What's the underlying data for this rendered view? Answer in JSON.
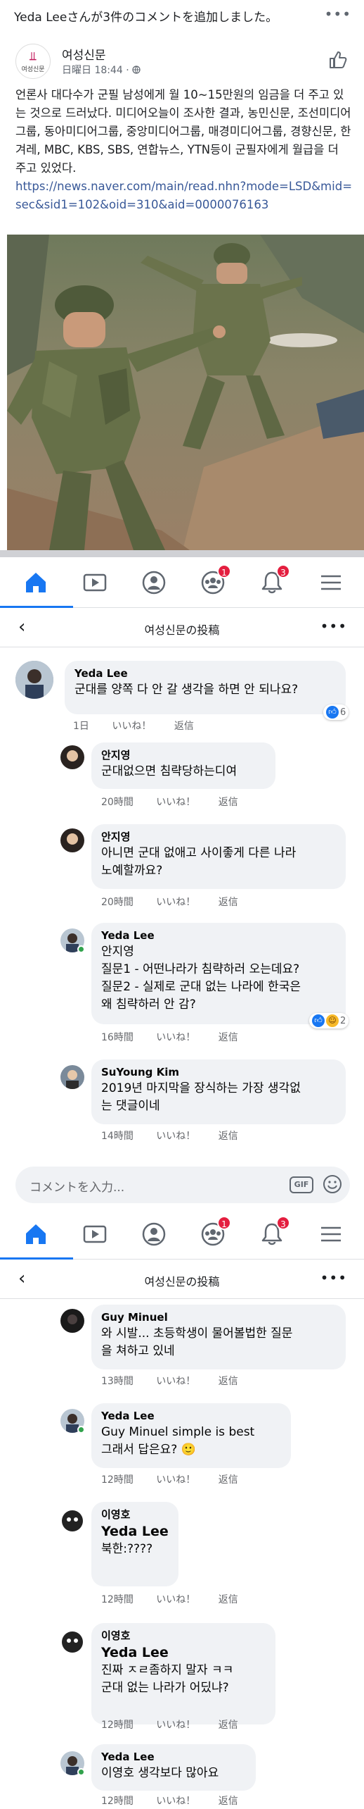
{
  "notification": {
    "text": "Yeda Leeさんが3件のコメントを追加しました。",
    "more": "•••"
  },
  "post": {
    "page_name": "여성신문",
    "logo_text": "여성신문",
    "time": "日曜日 18:44 · ",
    "text": "언론사 대다수가 군필 남성에게 월 10~15만원의 임금을 더 주고 있는 것으로 드러났다. 미디어오늘이 조사한 결과, 농민신문, 조선미디어그룹, 동아미디어그룹, 중앙미디어그룹, 매경미디어그룹, 경향신문, 한겨레, MBC, KBS, SBS, 연합뉴스, YTN등이 군필자에게 월급을 더 주고 있었다.",
    "link": "https://news.naver.com/main/read.nhn?mode=LSD&mid=sec&sid1=102&oid=310&aid=0000076163"
  },
  "nav": {
    "icons": [
      "home-icon",
      "video-icon",
      "profile-icon",
      "groups-icon",
      "notifications-icon",
      "menu-icon"
    ],
    "groups_badge": "1",
    "notifications_badge": "3"
  },
  "thread_header": {
    "title": "여성신문の投稿",
    "back": "‹",
    "more": "•••"
  },
  "comments_1": [
    {
      "name": "Yeda Lee",
      "text": "군대를 양쪽 다 안 갈 생각을 하면 안 되나요?",
      "time": "1日",
      "like": "いいね！",
      "reply": "返信",
      "react_count": "6"
    },
    {
      "name": "안지영",
      "text": "군대없으면 침략당하는디여",
      "time": "20時間",
      "like": "いいね！",
      "reply": "返信"
    },
    {
      "name": "안지영",
      "text": "아니면 군대 없애고 사이좋게 다른 나라\n노예할까요?",
      "time": "20時間",
      "like": "いいね！",
      "reply": "返信"
    },
    {
      "name": "Yeda Lee",
      "text": "안지영\n질문1 - 어떤나라가 침략하러 오는데요?\n질문2 - 실제로 군대 없는 나라에 한국은\n왜 침략하러 안 감?",
      "time": "16時間",
      "like": "いいね！",
      "reply": "返信",
      "react_count": "2"
    },
    {
      "name": "SuYoung Kim",
      "text": "2019년 마지막을 장식하는 가장 생각없\n는 댓글이네",
      "time": "14時間",
      "like": "いいね！",
      "reply": "返信"
    }
  ],
  "composer": {
    "placeholder": "コメントを入力...",
    "gif": "GIF"
  },
  "comments_2": [
    {
      "name": "Guy Minuel",
      "text": "와 시발... 초등학생이 물어볼법한 질문\n을 쳐하고 있네",
      "time": "13時間",
      "like": "いいね！",
      "reply": "返信"
    },
    {
      "name": "Yeda Lee",
      "text": "Guy Minuel simple is best\n그래서 답은요? 🙂",
      "time": "12時間",
      "like": "いいね！",
      "reply": "返信"
    },
    {
      "name": "이영호",
      "mention": "Yeda Lee",
      "text": "북한:????",
      "time": "12時間",
      "like": "いいね！",
      "reply": "返信"
    },
    {
      "name": "이영호",
      "mention": "Yeda Lee",
      "text": "진짜 ㅈㄹ좀하지 말자 ㅋㅋ\n군대 없는 나라가 어딨냐?",
      "time": "12時間",
      "like": "いいね！",
      "reply": "返信"
    },
    {
      "name": "Yeda Lee",
      "text": "이영호 생각보다 많아요",
      "time": "12時間",
      "like": "いいね！",
      "reply": "返信"
    }
  ],
  "colors": {
    "facebook_blue": "#1877f2",
    "badge_red": "#e41e3f",
    "bubble_gray": "#f0f2f5"
  }
}
